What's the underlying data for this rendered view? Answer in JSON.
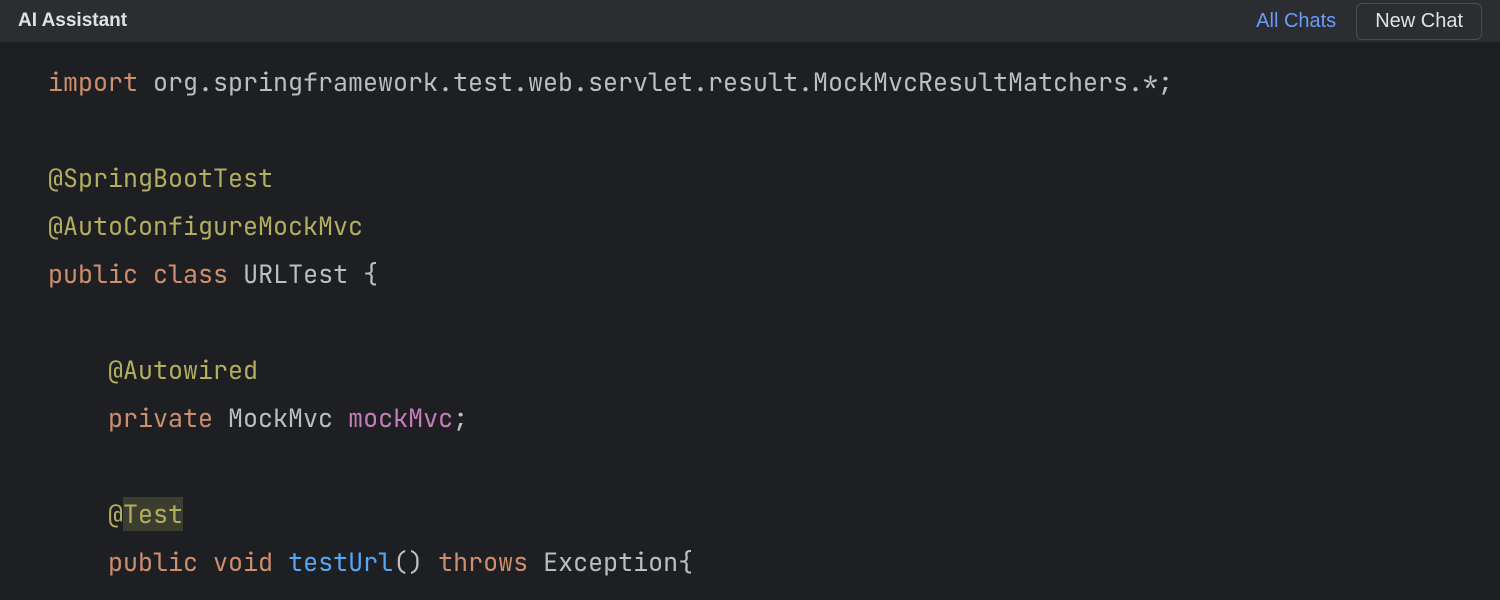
{
  "header": {
    "title": "AI Assistant",
    "all_chats": "All Chats",
    "new_chat": "New Chat"
  },
  "code": {
    "line1": {
      "import": "import",
      "rest": " org.springframework.test.web.servlet.result.MockMvcResultMatchers.*;"
    },
    "line3": {
      "annotation": "@SpringBootTest"
    },
    "line4": {
      "annotation": "@AutoConfigureMockMvc"
    },
    "line5": {
      "public": "public",
      "sp1": " ",
      "class": "class",
      "sp2": " ",
      "name": "URLTest",
      "brace": " {"
    },
    "line7": {
      "indent": "    ",
      "annotation": "@Autowired"
    },
    "line8": {
      "indent": "    ",
      "private": "private",
      "sp1": " ",
      "type": "MockMvc",
      "sp2": " ",
      "field": "mockMvc",
      "semi": ";"
    },
    "line10": {
      "indent": "    ",
      "at": "@",
      "test": "Test"
    },
    "line11": {
      "indent": "    ",
      "public": "public",
      "sp1": " ",
      "void": "void",
      "sp2": " ",
      "method": "testUrl",
      "parens": "()",
      "sp3": " ",
      "throws": "throws",
      "sp4": " ",
      "exc": "Exception",
      "brace": "{"
    }
  }
}
